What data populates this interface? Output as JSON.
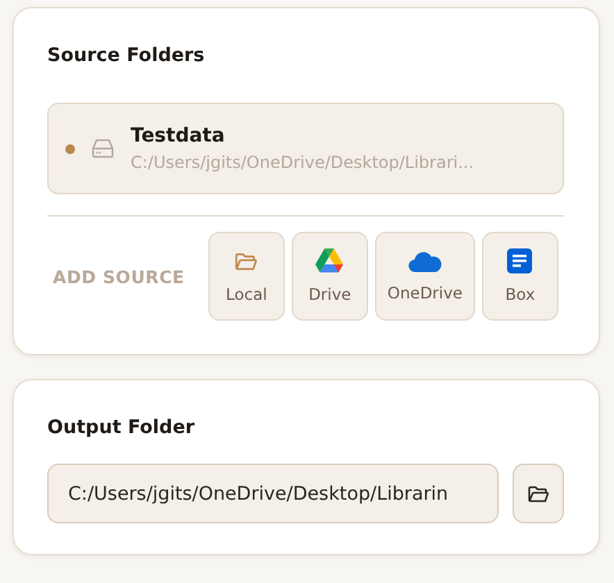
{
  "source_folders": {
    "title": "Source Folders",
    "items": [
      {
        "name": "Testdata",
        "path": "C:/Users/jgits/OneDrive/Desktop/Librari...",
        "color": "#b8894e"
      }
    ],
    "add_source": {
      "label": "ADD SOURCE",
      "buttons": [
        {
          "kind": "local",
          "label": "Local"
        },
        {
          "kind": "drive",
          "label": "Drive"
        },
        {
          "kind": "onedrive",
          "label": "OneDrive"
        },
        {
          "kind": "box",
          "label": "Box"
        }
      ]
    }
  },
  "output_folder": {
    "title": "Output Folder",
    "value": "C:/Users/jgits/OneDrive/Desktop/Librarin"
  }
}
